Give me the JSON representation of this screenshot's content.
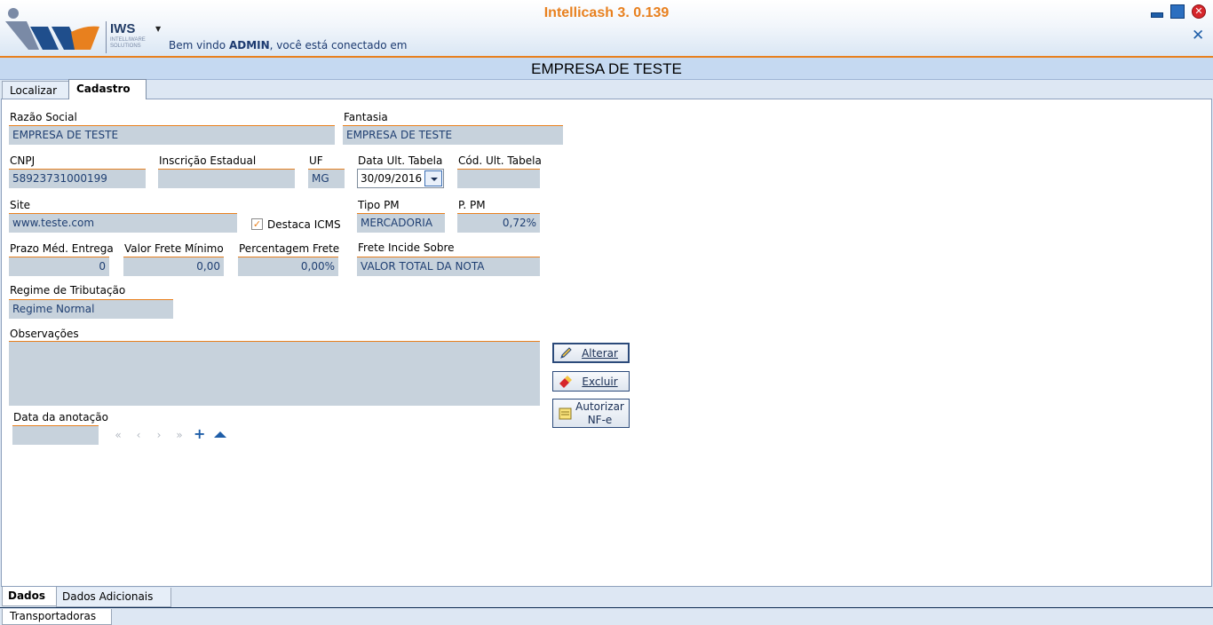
{
  "app": {
    "title": "Intellicash 3. 0.139",
    "logo_text": "IWS",
    "logo_subtext": "INTELLIWARE SOLUTIONS",
    "welcome_prefix": "Bem vindo",
    "welcome_user": "ADMIN",
    "welcome_suffix": ", você está conectado em",
    "colors": {
      "accent": "#e8801e",
      "brand": "#1f5ea8",
      "field_bg": "#c7d2dc"
    }
  },
  "page": {
    "title": "EMPRESA DE TESTE"
  },
  "tabs": [
    {
      "label": "Localizar"
    },
    {
      "label": "Cadastro"
    }
  ],
  "form": {
    "razao_social": {
      "label": "Razão Social",
      "value": "EMPRESA DE TESTE"
    },
    "fantasia": {
      "label": "Fantasia",
      "value": "EMPRESA DE TESTE"
    },
    "cnpj": {
      "label": "CNPJ",
      "value": "58923731000199"
    },
    "inscricao_estadual": {
      "label": "Inscrição Estadual",
      "value": ""
    },
    "uf": {
      "label": "UF",
      "value": "MG"
    },
    "data_ult_tabela": {
      "label": "Data Ult. Tabela",
      "value": "30/09/2016"
    },
    "cod_ult_tabela": {
      "label": "Cód. Ult. Tabela",
      "value": ""
    },
    "site": {
      "label": "Site",
      "value": "www.teste.com"
    },
    "destaca_icms": {
      "label": "Destaca ICMS",
      "checked": true
    },
    "tipo_pm": {
      "label": "Tipo PM",
      "value": "MERCADORIA"
    },
    "p_pm": {
      "label": "P. PM",
      "value": "0,72%"
    },
    "prazo_med_entrega": {
      "label": "Prazo Méd. Entrega",
      "value": "0"
    },
    "valor_frete_minimo": {
      "label": "Valor Frete Mínimo",
      "value": "0,00"
    },
    "percentagem_frete": {
      "label": "Percentagem Frete",
      "value": "0,00%"
    },
    "frete_incide_sobre": {
      "label": "Frete Incide Sobre",
      "value": "VALOR TOTAL DA NOTA"
    },
    "regime_tributacao": {
      "label": "Regime de Tributação",
      "value": "Regime Normal"
    },
    "observacoes": {
      "label": "Observações",
      "value": ""
    },
    "data_anotacao": {
      "label": "Data da anotação",
      "value": ""
    }
  },
  "buttons": {
    "alterar": "Alterar",
    "excluir": "Excluir",
    "autorizar_line1": "Autorizar",
    "autorizar_line2": "NF-e"
  },
  "bottom_tabs": [
    {
      "label": "Dados"
    },
    {
      "label": "Dados Adicionais"
    }
  ],
  "bottom_strip": {
    "label": "Transportadoras"
  }
}
